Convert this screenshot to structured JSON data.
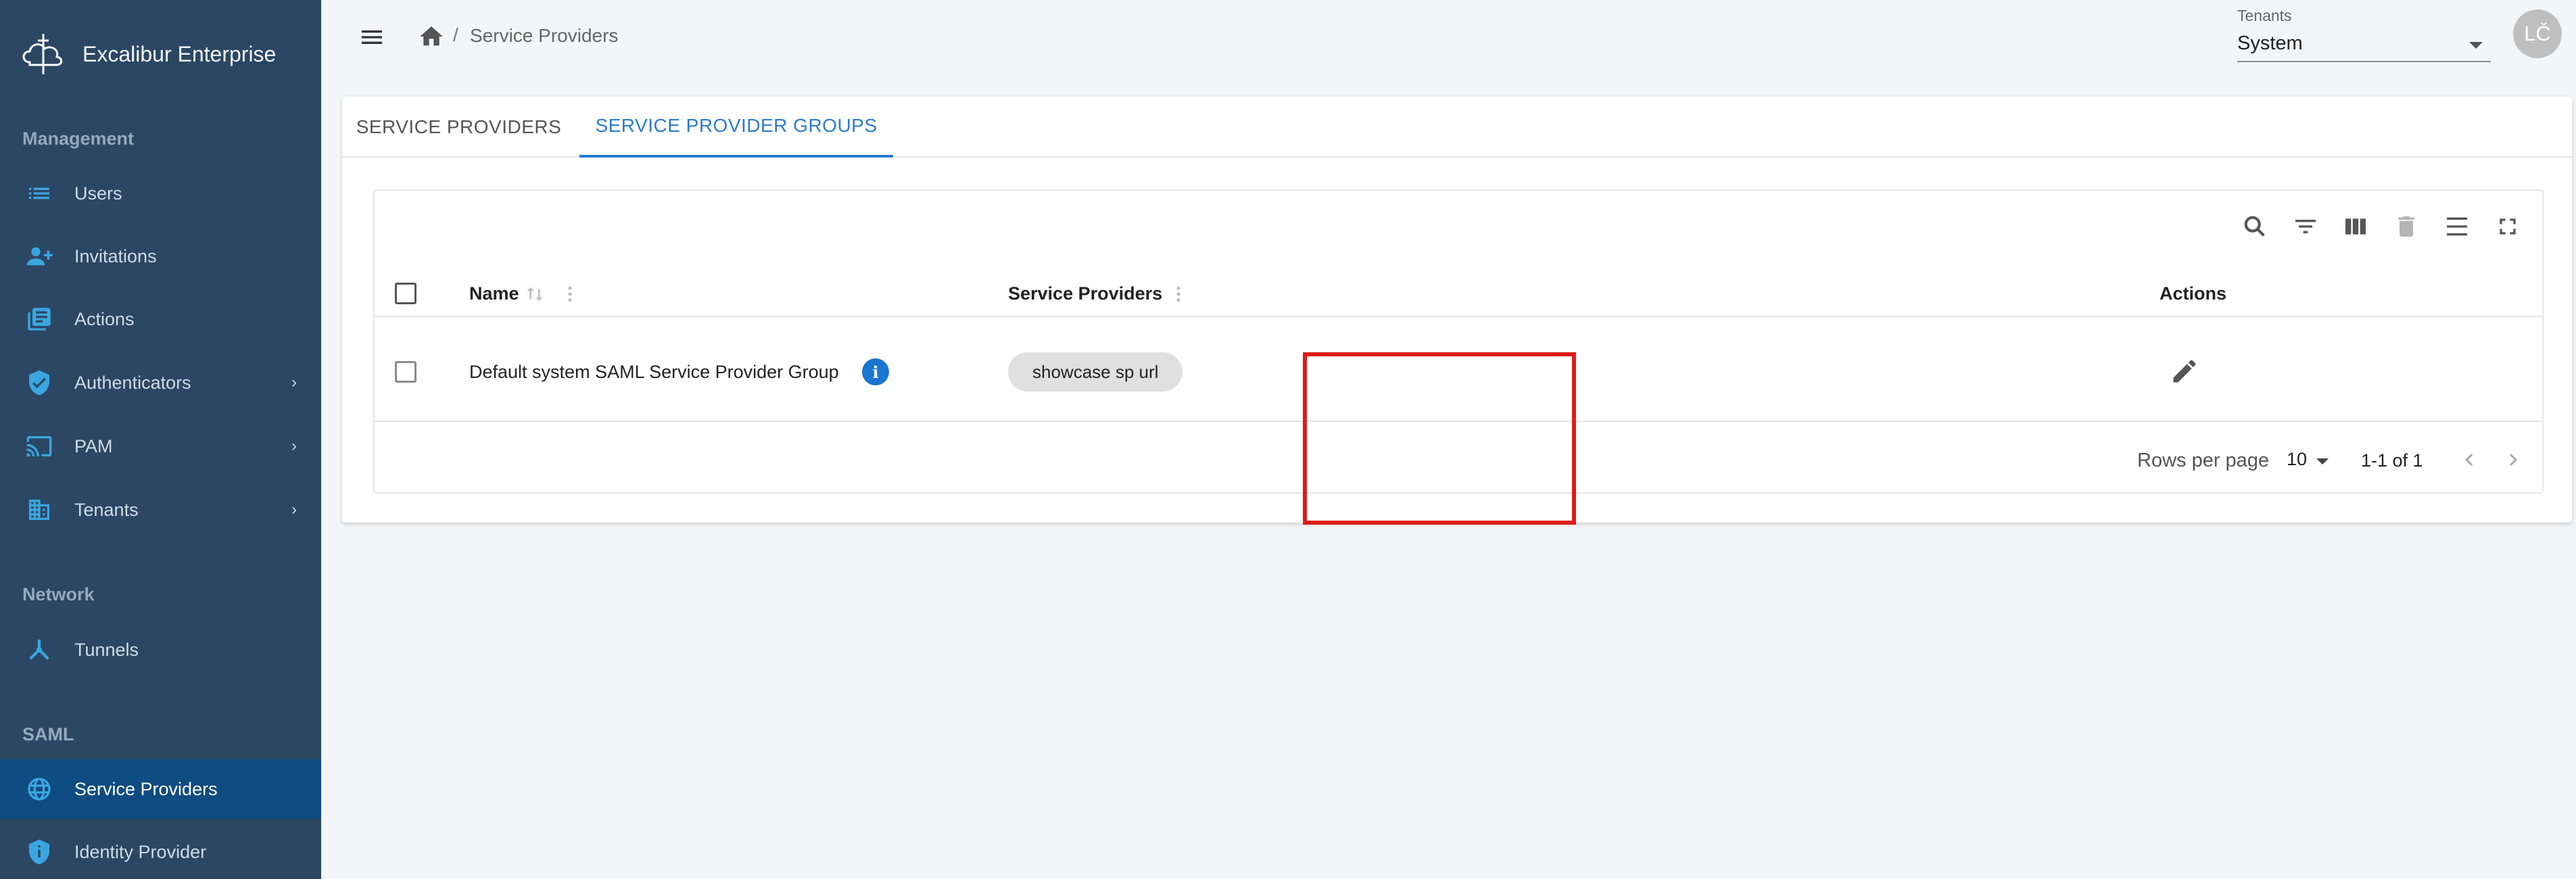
{
  "app": {
    "brand": "Excalibur Enterprise"
  },
  "sidebar": {
    "sections": [
      {
        "title": "Management"
      },
      {
        "title": "Network"
      },
      {
        "title": "SAML"
      }
    ],
    "items": [
      {
        "label": "Users",
        "icon": "list-icon"
      },
      {
        "label": "Invitations",
        "icon": "person-add-icon"
      },
      {
        "label": "Actions",
        "icon": "library-books-icon"
      },
      {
        "label": "Authenticators",
        "icon": "verified-shield-icon",
        "chevron": "›"
      },
      {
        "label": "PAM",
        "icon": "cast-icon",
        "chevron": "›"
      },
      {
        "label": "Tenants",
        "icon": "building-icon",
        "chevron": "›"
      },
      {
        "label": "Tunnels",
        "icon": "hub-icon"
      },
      {
        "label": "Service Providers",
        "icon": "globe-icon",
        "active": true
      },
      {
        "label": "Identity Provider",
        "icon": "shield-info-icon"
      }
    ]
  },
  "topbar": {
    "breadcrumb_sep": "/",
    "breadcrumb": "Service Providers",
    "tenants_label": "Tenants",
    "tenants_value": "System",
    "avatar_initials": "LČ"
  },
  "tabs": [
    {
      "label": "SERVICE PROVIDERS",
      "active": false
    },
    {
      "label": "SERVICE PROVIDER GROUPS",
      "active": true
    }
  ],
  "table": {
    "columns": {
      "name": "Name",
      "service_providers": "Service Providers",
      "actions": "Actions"
    },
    "rows": [
      {
        "name": "Default system SAML Service Provider Group",
        "service_providers": [
          "showcase sp url"
        ]
      }
    ],
    "pagination": {
      "rows_per_page_label": "Rows per page",
      "rows_per_page": "10",
      "range": "1-1 of 1"
    }
  },
  "colors": {
    "sidebar_bg": "#2b4763",
    "active_item_bg": "#0f4c81",
    "accent": "#2a7bd0",
    "highlight": "#e01b1b",
    "icon_blue": "#3aa6e0"
  }
}
